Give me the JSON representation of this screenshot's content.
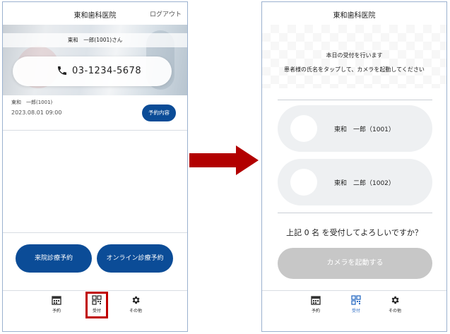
{
  "left": {
    "header": {
      "title": "東和歯科医院",
      "logout": "ログアウト"
    },
    "hero": {
      "patient_greeting": "東和　一郎(1001)さん",
      "phone": "03-1234-5678"
    },
    "appointment": {
      "name": "東和　一郎(1001)",
      "datetime": "2023.08.01 09:00",
      "detail_button": "予約内容"
    },
    "actions": {
      "visit_button": "来院診療予約",
      "online_button": "オンライン診療予約"
    },
    "nav": [
      {
        "label": "予約",
        "icon": "calendar-icon",
        "active": false
      },
      {
        "label": "受付",
        "icon": "qr-code-icon",
        "active": true
      },
      {
        "label": "その他",
        "icon": "gear-icon",
        "active": false
      }
    ]
  },
  "right": {
    "header": {
      "title": "東和歯科医院"
    },
    "instructions": [
      "本日の受付を行います",
      "患者様の氏名をタップして、カメラを起動してください"
    ],
    "patients": [
      {
        "name": "東和　一郎（1001）"
      },
      {
        "name": "東和　二郎（1002）"
      }
    ],
    "confirm_text": "上記 0 名 を受付してよろしいですか？",
    "camera_button": "カメラを起動する",
    "nav": [
      {
        "label": "予約",
        "icon": "calendar-icon",
        "active": false
      },
      {
        "label": "受付",
        "icon": "qr-code-icon",
        "active": true
      },
      {
        "label": "その他",
        "icon": "gear-icon",
        "active": false
      }
    ]
  },
  "colors": {
    "primary": "#0b4c97",
    "highlight": "#c00000",
    "arrow": "#b20000",
    "disabled": "#c7c7c7",
    "active_nav": "#2b6cc4"
  }
}
